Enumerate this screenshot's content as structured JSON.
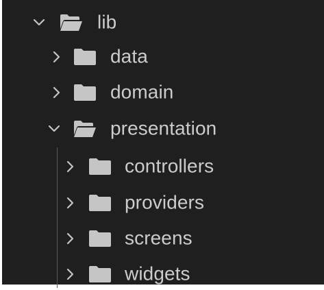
{
  "tree": {
    "root": {
      "label": "lib",
      "expanded": true,
      "icon": "folder-open-icon"
    },
    "children": [
      {
        "label": "data",
        "expanded": false,
        "icon": "folder-icon"
      },
      {
        "label": "domain",
        "expanded": false,
        "icon": "folder-icon"
      },
      {
        "label": "presentation",
        "expanded": true,
        "icon": "folder-open-icon",
        "children": [
          {
            "label": "controllers",
            "expanded": false,
            "icon": "folder-icon"
          },
          {
            "label": "providers",
            "expanded": false,
            "icon": "folder-icon"
          },
          {
            "label": "screens",
            "expanded": false,
            "icon": "folder-icon"
          },
          {
            "label": "widgets",
            "expanded": false,
            "icon": "folder-icon"
          }
        ]
      }
    ]
  },
  "colors": {
    "background": "#1f1f1f",
    "text": "#cccccc",
    "icon": "#c5c5c5",
    "indent_guide": "#585858"
  }
}
